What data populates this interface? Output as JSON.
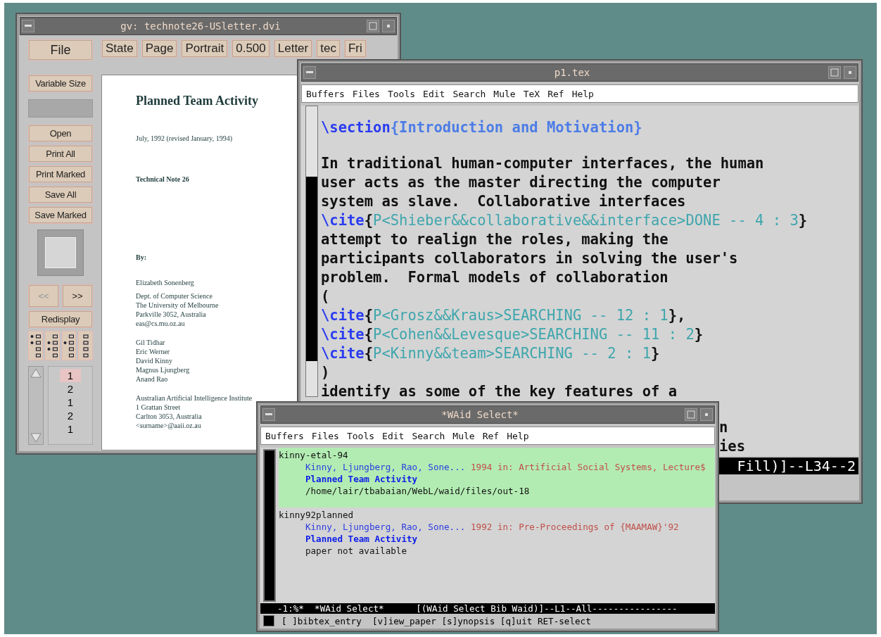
{
  "viewer_window": {
    "title": "gv: technote26-USletter.dvi",
    "file_button": "File",
    "toolbar": [
      {
        "label": "State"
      },
      {
        "label": "Page"
      },
      {
        "label": "Portrait"
      },
      {
        "label": "0.500"
      },
      {
        "label": "Letter"
      },
      {
        "label": "tec"
      },
      {
        "label": "Fri"
      }
    ],
    "size_button": "Variable Size",
    "side_buttons": [
      "Open",
      "Print All",
      "Print Marked",
      "Save All",
      "Save Marked"
    ],
    "nav_buttons": [
      {
        "label": "<<",
        "disabled": true
      },
      {
        "label": ">>",
        "disabled": false
      }
    ],
    "redisplay_button": "Redisplay",
    "page_list": [
      {
        "label": "1",
        "selected": true
      },
      {
        "label": "2",
        "selected": false
      },
      {
        "label": "1",
        "selected": false
      },
      {
        "label": "2",
        "selected": false
      },
      {
        "label": "1",
        "selected": false
      }
    ],
    "document": {
      "title": "Planned Team Activity",
      "date": "July, 1992 (revised January, 1994)",
      "note": "Technical Note 26",
      "by": "By:",
      "author_blocks": [
        {
          "lines": [
            "Elizabeth Sonenberg"
          ]
        },
        {
          "lines": [
            "Dept. of Computer Science",
            "The University of Melbourne",
            "Parkville 3052, Australia",
            "eas@cs.mu.oz.au"
          ]
        },
        {
          "lines": [
            "Gil Tidhar",
            "Eric Werner",
            "David Kinny",
            "Magnus Ljungberg",
            "Anand Rao"
          ]
        },
        {
          "lines": [
            "Australian Artificial Intelligence Institute",
            "1 Grattan Street",
            "Carlton 3053, Australia",
            "<surname>@aaii.oz.au"
          ]
        }
      ]
    }
  },
  "editor_window": {
    "title": "p1.tex",
    "menu": [
      "Buffers",
      "Files",
      "Tools",
      "Edit",
      "Search",
      "Mule",
      "TeX",
      "Ref",
      "Help"
    ],
    "lines": [
      {
        "kind": "text",
        "segments": [
          {
            "text": "\\section",
            "kind": "command"
          },
          {
            "text": "{Introduction and Motivation}",
            "kind": "argument"
          }
        ]
      },
      {
        "kind": "blank"
      },
      {
        "kind": "text",
        "segments": [
          {
            "text": "In traditional human-computer interfaces, the human",
            "kind": "plain"
          }
        ]
      },
      {
        "kind": "text",
        "segments": [
          {
            "text": "user acts as the master directing the computer",
            "kind": "plain"
          }
        ]
      },
      {
        "kind": "text",
        "segments": [
          {
            "text": "system as slave.  Collaborative interfaces",
            "kind": "plain"
          }
        ]
      },
      {
        "kind": "text",
        "segments": [
          {
            "text": "\\cite",
            "kind": "command"
          },
          {
            "text": "{",
            "kind": "plain"
          },
          {
            "text": "P<Shieber&&collaborative&&interface>DONE -- 4 : 3",
            "kind": "citation"
          },
          {
            "text": "}",
            "kind": "plain"
          }
        ]
      },
      {
        "kind": "text",
        "segments": [
          {
            "text": "attempt to realign the roles, making the",
            "kind": "plain"
          }
        ]
      },
      {
        "kind": "text",
        "segments": [
          {
            "text": "participants collaborators in solving the user's",
            "kind": "plain"
          }
        ]
      },
      {
        "kind": "text",
        "segments": [
          {
            "text": "problem.  Formal models of collaboration",
            "kind": "plain"
          }
        ]
      },
      {
        "kind": "text",
        "segments": [
          {
            "text": "(",
            "kind": "plain"
          }
        ]
      },
      {
        "kind": "text",
        "segments": [
          {
            "text": "\\cite",
            "kind": "command"
          },
          {
            "text": "{",
            "kind": "plain"
          },
          {
            "text": "P<Grosz&&Kraus>SEARCHING -- 12 : 1",
            "kind": "citation"
          },
          {
            "text": "},",
            "kind": "plain"
          }
        ]
      },
      {
        "kind": "text",
        "segments": [
          {
            "text": "\\cite",
            "kind": "command"
          },
          {
            "text": "{",
            "kind": "plain"
          },
          {
            "text": "P<Cohen&&Levesque>SEARCHING -- 11 : 2",
            "kind": "citation"
          },
          {
            "text": "}",
            "kind": "plain"
          }
        ]
      },
      {
        "kind": "text",
        "segments": [
          {
            "text": "\\cite",
            "kind": "command"
          },
          {
            "text": "{",
            "kind": "plain"
          },
          {
            "text": "P<Kinny&&team>SEARCHING -- 2 : 1",
            "kind": "citation"
          },
          {
            "text": "}",
            "kind": "plain"
          }
        ]
      },
      {
        "kind": "text",
        "segments": [
          {
            "text": ")",
            "kind": "plain"
          }
        ]
      },
      {
        "kind": "text",
        "segments": [
          {
            "text": "identify as some of the key features of a",
            "kind": "plain"
          }
        ]
      }
    ],
    "partial_lines": [
      "n",
      "ies"
    ],
    "mode_line": "Fill)]--L34--2"
  },
  "select_window": {
    "title": "*WAid Select*",
    "menu": [
      "Buffers",
      "Files",
      "Tools",
      "Edit",
      "Search",
      "Mule",
      "Ref",
      "Help"
    ],
    "entries": [
      {
        "key": "kinny-etal-94",
        "authors": "Kinny, Ljungberg, Rao, Sone...",
        "venue": "1994 in: Artificial Social Systems, Lecture$",
        "title": "Planned Team Activity",
        "location": "/home/lair/tbabaian/WebL/waid/files/out-18",
        "selected": true
      },
      {
        "key": "kinny92planned",
        "authors": "Kinny, Ljungberg, Rao, Sone...",
        "venue": "1992 in: Pre-Proceedings of {MAAMAW}'92",
        "title": "Planned Team Activity",
        "location": "paper not available",
        "selected": false
      }
    ],
    "mode_line": "-1:%*  *WAid Select*      [(WAid Select Bib Waid)]--L1--All----------------",
    "echo_line": "[ ]bibtex_entry  [v]iew_paper [s]ynopsis [q]uit RET-select"
  }
}
